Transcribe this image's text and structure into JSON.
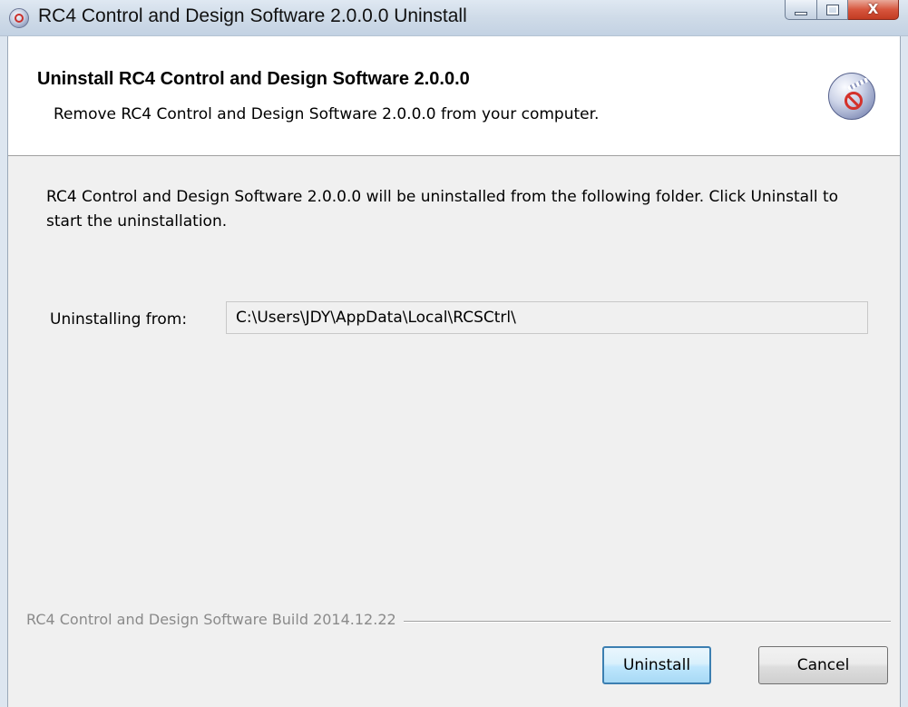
{
  "window": {
    "title": "RC4 Control and Design Software 2.0.0.0 Uninstall",
    "close_glyph": "X"
  },
  "header": {
    "title": "Uninstall RC4 Control and Design Software 2.0.0.0",
    "subtitle": "Remove RC4 Control and Design Software 2.0.0.0 from your computer.",
    "icon": "uninstall-disc-icon"
  },
  "body": {
    "description": "RC4 Control and Design Software 2.0.0.0 will be uninstalled from the following folder. Click Uninstall to start the uninstallation.",
    "from_label": "Uninstalling from:",
    "from_value": "C:\\Users\\JDY\\AppData\\Local\\RCSCtrl\\"
  },
  "footer": {
    "branding": "RC4 Control and Design Software Build 2014.12.22",
    "uninstall_label": "Uninstall",
    "cancel_label": "Cancel"
  },
  "colors": {
    "default_button_border": "#3c7fb1",
    "close_button": "#c23b22",
    "header_background": "#ffffff",
    "dialog_background": "#f0f0f0"
  }
}
